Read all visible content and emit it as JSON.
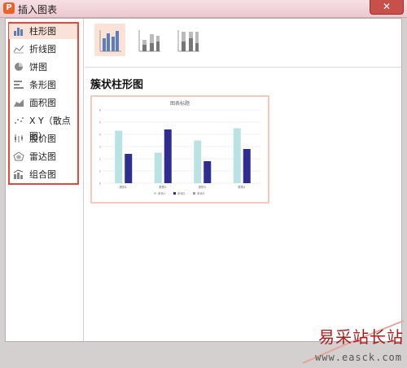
{
  "window": {
    "title": "插入图表",
    "app_icon": "P",
    "close_label": "✕"
  },
  "sidebar": {
    "items": [
      {
        "label": "柱形图",
        "icon": "column-chart-icon",
        "selected": true
      },
      {
        "label": "折线图",
        "icon": "line-chart-icon"
      },
      {
        "label": "饼图",
        "icon": "pie-chart-icon"
      },
      {
        "label": "条形图",
        "icon": "bar-chart-icon"
      },
      {
        "label": "面积图",
        "icon": "area-chart-icon"
      },
      {
        "label": "X Y（散点图）",
        "icon": "scatter-chart-icon"
      },
      {
        "label": "股价图",
        "icon": "stock-chart-icon"
      },
      {
        "label": "雷达图",
        "icon": "radar-chart-icon"
      },
      {
        "label": "组合图",
        "icon": "combo-chart-icon"
      }
    ]
  },
  "subtypes": [
    {
      "name": "clustered-column",
      "selected": true
    },
    {
      "name": "stacked-column"
    },
    {
      "name": "percent-stacked-column"
    }
  ],
  "main": {
    "section_title": "簇状柱形图"
  },
  "preview": {
    "title": "图表标题",
    "colors": {
      "series1": "#b9e3e3",
      "series2": "#2d2e8f",
      "series3": "#9e9e9e"
    },
    "chart_data": {
      "type": "bar",
      "title": "图表标题",
      "categories": [
        "类别1",
        "类别2",
        "类别3",
        "类别4"
      ],
      "series": [
        {
          "name": "系列1",
          "values": [
            4.3,
            2.5,
            3.5,
            4.5
          ]
        },
        {
          "name": "系列2",
          "values": [
            2.4,
            4.4,
            1.8,
            2.8
          ]
        }
      ],
      "ylim": [
        0,
        6
      ],
      "yticks": [
        "0",
        "1",
        "2",
        "3",
        "4",
        "5",
        "6"
      ],
      "legend": "bottom",
      "legend_entries": [
        "系列1",
        "系列2",
        "系列3"
      ],
      "grid": true
    }
  },
  "watermark": {
    "title": "易采站长站",
    "url": "www.easck.com"
  }
}
